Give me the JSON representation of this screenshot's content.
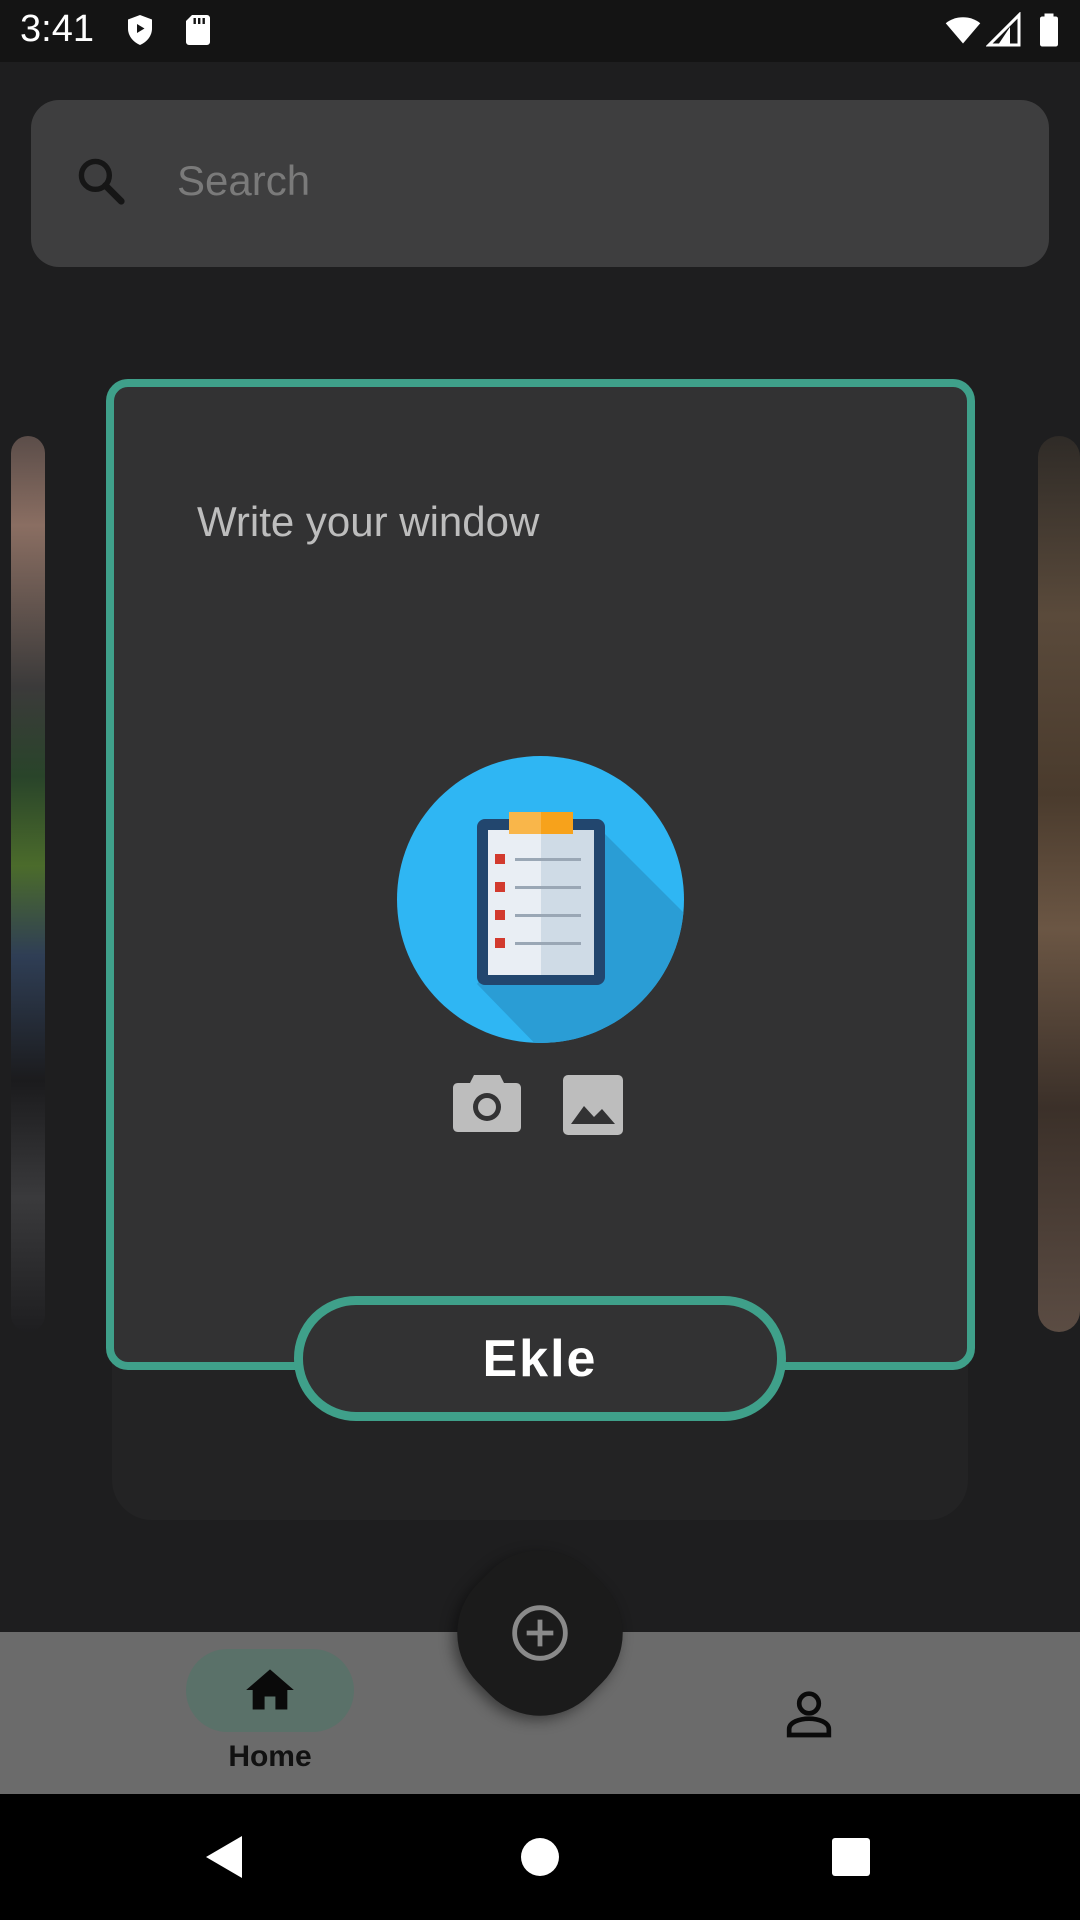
{
  "status_bar": {
    "time": "3:41",
    "left_icons": [
      "shield-icon",
      "sd-card-icon"
    ],
    "right_icons": [
      "wifi-icon",
      "cellular-signal-icon",
      "battery-icon"
    ]
  },
  "search": {
    "placeholder": "Search"
  },
  "dialog": {
    "input_placeholder": "Write your window",
    "illustration": "clipboard-checklist-icon",
    "media_actions": [
      "camera-icon",
      "image-icon"
    ],
    "submit_label": "Ekle"
  },
  "bottom_nav": {
    "items": [
      {
        "label": "Home",
        "icon": "home-icon",
        "selected": true
      },
      {
        "label": "",
        "icon": "person-icon",
        "selected": false
      }
    ],
    "fab_icon": "add-circle-icon"
  },
  "system_nav": [
    "back-icon",
    "home-circle-icon",
    "recents-icon"
  ],
  "colors": {
    "accent": "#3fa08a",
    "dialog_bg": "#323233",
    "illustration_blue": "#2fb6f3"
  }
}
